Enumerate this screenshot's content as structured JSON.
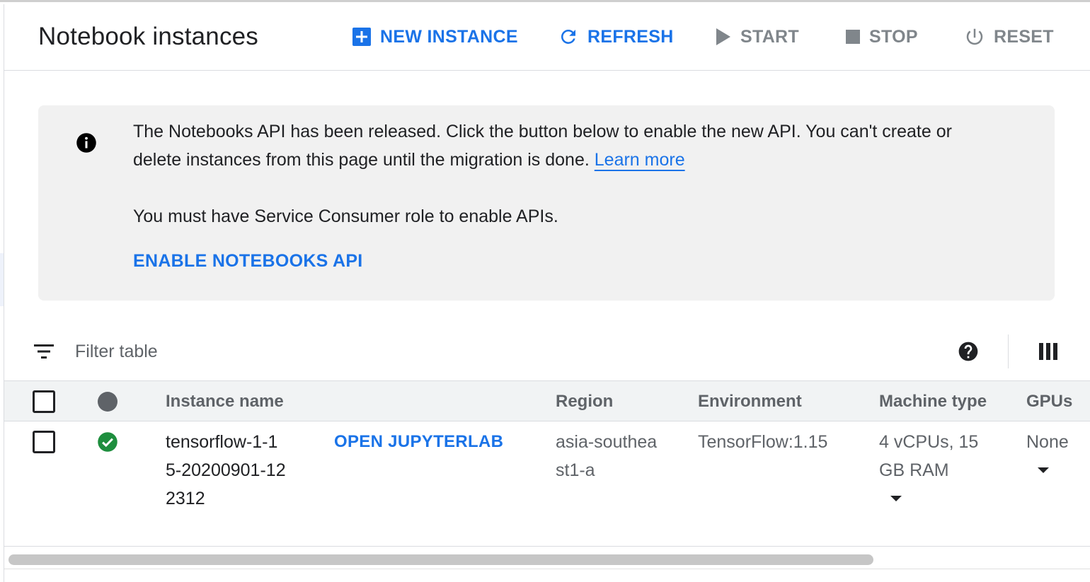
{
  "header": {
    "title": "Notebook instances",
    "actions": [
      {
        "label": "NEW INSTANCE",
        "icon": "add-box-icon",
        "state": "enabled"
      },
      {
        "label": "REFRESH",
        "icon": "refresh-icon",
        "state": "enabled"
      },
      {
        "label": "START",
        "icon": "play-icon",
        "state": "disabled"
      },
      {
        "label": "STOP",
        "icon": "stop-icon",
        "state": "disabled"
      },
      {
        "label": "RESET",
        "icon": "power-icon",
        "state": "disabled"
      }
    ]
  },
  "banner": {
    "icon": "info-icon",
    "message": "The Notebooks API has been released. Click the button below to enable the new API. You can't create or delete instances from this page until the migration is done.",
    "link_label": "Learn more",
    "role_note": "You must have Service Consumer role to enable APIs.",
    "button_label": "ENABLE NOTEBOOKS API"
  },
  "filter": {
    "placeholder": "Filter table",
    "icons": [
      "filter-icon",
      "help-icon",
      "columns-icon"
    ]
  },
  "table": {
    "columns": [
      "Instance name",
      "Region",
      "Environment",
      "Machine type",
      "GPUs"
    ],
    "rows": [
      {
        "selected": false,
        "status": "running",
        "instance_name": "tensorflow-1-15-20200901-122312",
        "action_label": "OPEN JUPYTERLAB",
        "region": "asia-southeast1-a",
        "environment": "TensorFlow:1.15",
        "machine_type": "4 vCPUs, 15 GB RAM",
        "gpus": "None"
      }
    ]
  },
  "colors": {
    "accent": "#1a73e8",
    "success": "#1e8e3e",
    "disabled": "#80868b",
    "banner_bg": "#f1f1f1"
  }
}
